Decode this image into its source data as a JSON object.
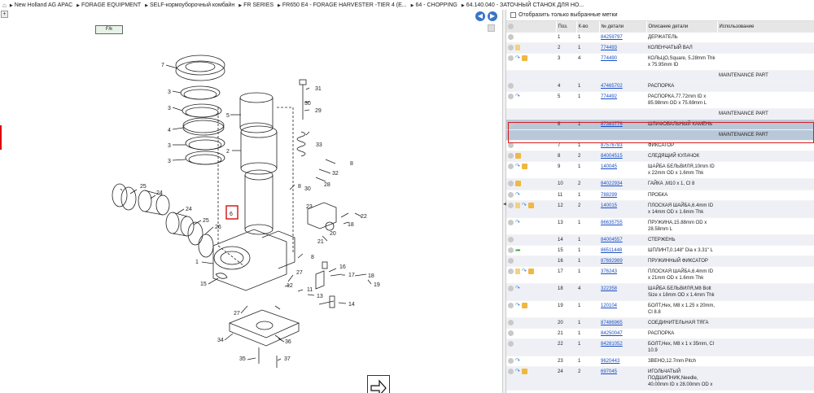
{
  "breadcrumb": {
    "home_icon": "home-icon",
    "items": [
      "New Holland AG APAC",
      "FORAGE EQUIPMENT",
      "SELF-кормоуборочный комбайн",
      "FR SERIES",
      "FR650 E4 - FORAGE HARVESTER -TIER 4 (E...",
      "64 - CHOPPING",
      "64.140.040 - ЗАТОЧНЫЙ СТАНОК ДЛЯ НО..."
    ]
  },
  "diagram": {
    "zoom_label": "+",
    "tag_label": "F/k",
    "prev_icon": "arrow-left-icon",
    "next_icon": "arrow-right-icon",
    "callouts": [
      "7",
      "3",
      "3",
      "4",
      "3",
      "3",
      "5",
      "2",
      "31",
      "30",
      "29",
      "33",
      "8",
      "32",
      "28",
      "25",
      "24",
      "24",
      "25",
      "26",
      "23",
      "22",
      "18",
      "20",
      "21",
      "8",
      "1",
      "16",
      "17",
      "18",
      "19",
      "27",
      "12",
      "11",
      "13",
      "15",
      "14",
      "27",
      "34",
      "36",
      "35",
      "37",
      "6",
      "30",
      "8"
    ]
  },
  "filter": {
    "label": "Отобразить только выбранные метки"
  },
  "table": {
    "headers": [
      "",
      "Поз.",
      "К-во",
      "№ детали",
      "Описание детали",
      "Использование"
    ],
    "rows": [
      {
        "pos": "1",
        "qty": "1",
        "part": "84259797",
        "desc": "ДЕРЖАТЕЛЬ",
        "icons": [
          "circle"
        ]
      },
      {
        "pos": "2",
        "qty": "1",
        "part": "774493",
        "desc": "КОЛЕНЧАТЫЙ ВАЛ",
        "icons": [
          "circle",
          "doc"
        ]
      },
      {
        "pos": "3",
        "qty": "4",
        "part": "774490",
        "desc": "КОЛЬЦО,Square, 5.28mm Thk x 75.95mm ID",
        "icons": [
          "circle",
          "blue",
          "box"
        ]
      },
      {
        "note": "MAINTENANCE PART"
      },
      {
        "pos": "4",
        "qty": "1",
        "part": "47465702",
        "desc": "РАСПОРКА",
        "icons": [
          "circle"
        ]
      },
      {
        "pos": "5",
        "qty": "1",
        "part": "774492",
        "desc": "РАСПОРКА,77.72mm ID x 85.98mm OD x 75.69mm L",
        "icons": [
          "circle",
          "blue"
        ]
      },
      {
        "note": "MAINTENANCE PART"
      },
      {
        "pos": "6",
        "qty": "1",
        "part": "87383776",
        "desc": "ШЛИФОВАЛЬНЫЙ КАМЕНЬ",
        "icons": [
          "circle"
        ],
        "selected": true
      },
      {
        "note": "MAINTENANCE PART",
        "selected": true
      },
      {
        "pos": "7",
        "qty": "1",
        "part": "87576783",
        "desc": "ФИКСАТОР",
        "icons": [
          "circle"
        ]
      },
      {
        "pos": "8",
        "qty": "2",
        "part": "84004515",
        "desc": "СЛЕДЯЩИЙ КУЛАЧОК",
        "icons": [
          "circle",
          "box"
        ]
      },
      {
        "pos": "9",
        "qty": "1",
        "part": "140045",
        "desc": "ШАЙБА БЕЛЬВИЛЯ,10mm ID x 22mm OD x 1.6mm Thk",
        "icons": [
          "circle",
          "blue",
          "box"
        ]
      },
      {
        "pos": "10",
        "qty": "2",
        "part": "84022934",
        "desc": "ГАЙКА ,M10 x 1, Cl 8",
        "icons": [
          "circle",
          "box"
        ]
      },
      {
        "pos": "11",
        "qty": "1",
        "part": "788299",
        "desc": "ПРОБКА",
        "icons": [
          "circle",
          "blue"
        ]
      },
      {
        "pos": "12",
        "qty": "2",
        "part": "140015",
        "desc": "ПЛОСКАЯ ШАЙБА,6.4mm ID x 14mm OD x 1.6mm Thk",
        "icons": [
          "circle",
          "doc",
          "blue",
          "box"
        ]
      },
      {
        "pos": "13",
        "qty": "1",
        "part": "86635755",
        "desc": "ПРУЖИНА,15.88mm OD x 28.58mm L",
        "icons": [
          "circle",
          "blue"
        ]
      },
      {
        "pos": "14",
        "qty": "1",
        "part": "84004557",
        "desc": "СТЕРЖЕНЬ",
        "icons": [
          "circle"
        ]
      },
      {
        "pos": "15",
        "qty": "1",
        "part": "86511448",
        "desc": "ШПЛИНТ,0.148\" Dia x 3.31\" L",
        "icons": [
          "circle",
          "green"
        ]
      },
      {
        "pos": "16",
        "qty": "1",
        "part": "87692989",
        "desc": "ПРУЖИННЫЙ ФИКСАТОР",
        "icons": [
          "circle"
        ]
      },
      {
        "pos": "17",
        "qty": "1",
        "part": "376243",
        "desc": "ПЛОСКАЯ ШАЙБА,6.4mm ID x 21mm OD x 1.6mm Thk",
        "icons": [
          "circle",
          "doc",
          "blue",
          "box"
        ]
      },
      {
        "pos": "18",
        "qty": "4",
        "part": "322358",
        "desc": "ШАЙБА БЕЛЬВИЛЯ,M8 Bolt Size x 18mm OD x 1.4mm Thk",
        "icons": [
          "circle",
          "blue"
        ]
      },
      {
        "pos": "19",
        "qty": "1",
        "part": "120104",
        "desc": "БОЛТ,Hex, M8 x 1.25 x 20mm, Cl 8.8",
        "icons": [
          "circle",
          "blue",
          "box"
        ]
      },
      {
        "pos": "20",
        "qty": "1",
        "part": "87486965",
        "desc": "СОЕДИНИТЕЛЬНАЯ ТЯГА",
        "icons": [
          "circle"
        ]
      },
      {
        "pos": "21",
        "qty": "1",
        "part": "84250047",
        "desc": "РАСПОРКА",
        "icons": [
          "circle"
        ]
      },
      {
        "pos": "22",
        "qty": "1",
        "part": "84281052",
        "desc": "БОЛТ,Hex, M8 x 1 x 35mm, Cl 10.9",
        "icons": [
          "circle"
        ]
      },
      {
        "pos": "23",
        "qty": "1",
        "part": "9620443",
        "desc": "ЗВЕНО,12.7mm Pitch",
        "icons": [
          "circle",
          "blue"
        ]
      },
      {
        "pos": "24",
        "qty": "2",
        "part": "697045",
        "desc": "ИГОЛЬЧАТЫЙ ПОДШИПНИК,Needle, 40.00mm ID x 28.00mm OD x",
        "icons": [
          "circle",
          "blue",
          "box"
        ]
      }
    ]
  }
}
